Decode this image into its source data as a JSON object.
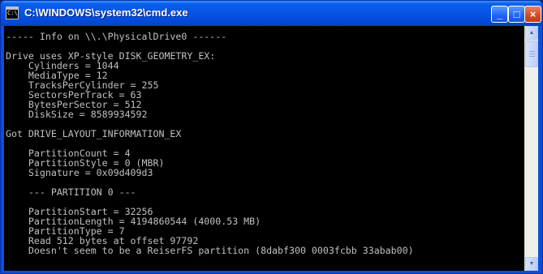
{
  "window": {
    "title": "C:\\WINDOWS\\system32\\cmd.exe",
    "app_icon_label": "C:\\",
    "min_label": "_",
    "max_label": "□",
    "close_label": "×"
  },
  "console": {
    "lines": [
      "----- Info on \\\\.\\PhysicalDrive0 ------",
      "",
      "Drive uses XP-style DISK_GEOMETRY_EX:",
      "    Cylinders = 1044",
      "    MediaType = 12",
      "    TracksPerCylinder = 255",
      "    SectorsPerTrack = 63",
      "    BytesPerSector = 512",
      "    DiskSize = 8589934592",
      "",
      "Got DRIVE_LAYOUT_INFORMATION_EX",
      "",
      "    PartitionCount = 4",
      "    PartitionStyle = 0 (MBR)",
      "    Signature = 0x09d409d3",
      "",
      "    --- PARTITION 0 ---",
      "",
      "    PartitionStart = 32256",
      "    PartitionLength = 4194860544 (4000.53 MB)",
      "    PartitionType = 7",
      "    Read 512 bytes at offset 97792",
      "    Doesn't seem to be a ReiserFS partition (8dabf300 0003fcbb 33abab00)"
    ]
  },
  "scrollbar": {
    "up_arrow": "▲",
    "down_arrow": "▼"
  },
  "colors": {
    "console_bg": "#000000",
    "console_text": "#C0C0C0",
    "titlebar": "#0553E3",
    "close_button": "#D5471E"
  }
}
